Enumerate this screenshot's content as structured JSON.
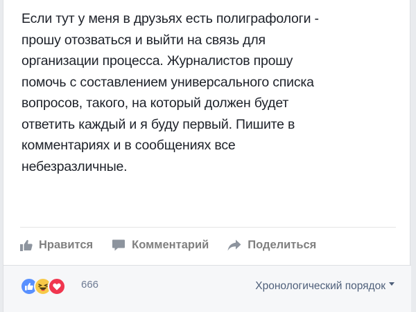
{
  "post": {
    "text": "Если тут у меня в друзьях есть полиграфологи -\nпрошу отозваться и выйти на связь для\nорганизации процесса. Журналистов прошу\nпомочь с составлением универсального списка\nвопросов, такого, на который должен будет\nответить каждый и я буду первый. Пишите в\nкомментариях и в сообщениях все\nнебезразличные."
  },
  "actions": {
    "like_label": "Нравится",
    "comment_label": "Комментарий",
    "share_label": "Поделиться",
    "like_icon": "thumbs-up-icon",
    "comment_icon": "speech-bubble-icon",
    "share_icon": "share-arrow-icon"
  },
  "reactions": {
    "types": [
      "like",
      "haha",
      "love"
    ],
    "count": "666"
  },
  "comments": {
    "sort_label": "Хронологический порядок"
  },
  "colors": {
    "like": "#5890ff",
    "haha": "#f7c948",
    "love": "#f0364f",
    "action_text": "#7f7f7f",
    "link_text": "#4e5f7a"
  }
}
